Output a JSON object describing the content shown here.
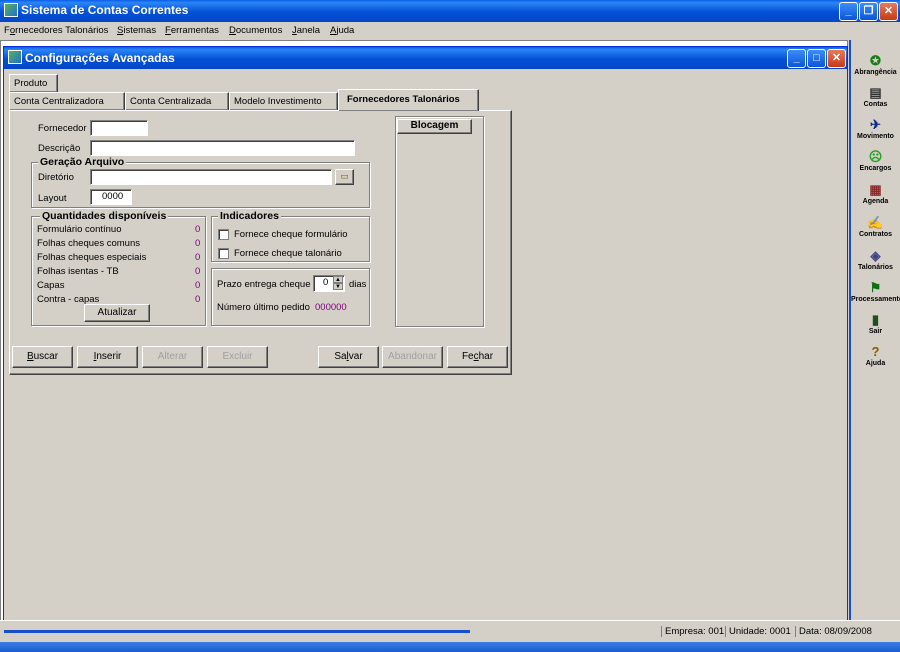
{
  "app": {
    "title": "Sistema de Contas Correntes",
    "menu": [
      {
        "pre": "F",
        "u": "o",
        "post": "rnecedores Talonários"
      },
      {
        "pre": "",
        "u": "S",
        "post": "istemas"
      },
      {
        "pre": "",
        "u": "F",
        "post": "erramentas"
      },
      {
        "pre": "",
        "u": "D",
        "post": "ocumentos"
      },
      {
        "pre": "",
        "u": "J",
        "post": "anela"
      },
      {
        "pre": "",
        "u": "A",
        "post": "juda"
      }
    ]
  },
  "window": {
    "title": "Configurações Avançadas",
    "tabs_row1": [
      "Produto"
    ],
    "tabs_row2": [
      "Conta Centralizadora",
      "Conta Centralizada",
      "Modelo Investimento",
      "Fornecedores Talonários"
    ],
    "form": {
      "fornecedor_label": "Fornecedor",
      "fornecedor_value": "",
      "descricao_label": "Descrição",
      "descricao_value": "",
      "geracao_title": "Geração Arquivo",
      "diretorio_label": "Diretório",
      "diretorio_value": "",
      "layout_label": "Layout",
      "layout_value": "0000",
      "quantidades_title": "Quantidades disponíveis",
      "quantidades": [
        {
          "label": "Formulário contínuo",
          "value": "0"
        },
        {
          "label": "Folhas cheques comuns",
          "value": "0"
        },
        {
          "label": "Folhas cheques especiais",
          "value": "0"
        },
        {
          "label": "Folhas isentas - TB",
          "value": "0"
        },
        {
          "label": "Capas",
          "value": "0"
        },
        {
          "label": "Contra - capas",
          "value": "0"
        }
      ],
      "atualizar": "Atualizar",
      "indicadores_title": "Indicadores",
      "chk_formulario": "Fornece cheque formulário",
      "chk_talonario": "Fornece cheque talonário",
      "prazo_label": "Prazo entrega cheque",
      "prazo_value": "0",
      "prazo_unit": "dias",
      "numero_label": "Número último pedido",
      "numero_value": "000000",
      "blocagem_header": "Blocagem"
    },
    "buttons": {
      "buscar": "Buscar",
      "inserir": "Inserir",
      "alterar": "Alterar",
      "excluir": "Excluir",
      "salvar": "Salvar",
      "abandonar": "Abandonar",
      "fechar": "Fechar"
    }
  },
  "sidebar": [
    {
      "label": "Abrangência",
      "icon": "globe-icon",
      "glyph": "✪",
      "color": "#1a7a1a"
    },
    {
      "label": "Contas",
      "icon": "document-icon",
      "glyph": "▤",
      "color": "#303030"
    },
    {
      "label": "Movimento",
      "icon": "runner-icon",
      "glyph": "✈",
      "color": "#102a8a"
    },
    {
      "label": "Encargos",
      "icon": "sad-face-icon",
      "glyph": "☹",
      "color": "#2aa02a"
    },
    {
      "label": "Agenda",
      "icon": "calendar-icon",
      "glyph": "▦",
      "color": "#8a2a2a"
    },
    {
      "label": "Contratos",
      "icon": "handshake-icon",
      "glyph": "✍",
      "color": "#806020"
    },
    {
      "label": "Talonários",
      "icon": "checkbook-icon",
      "glyph": "◈",
      "color": "#404080"
    },
    {
      "label": "Processamento",
      "icon": "flag-icon",
      "glyph": "⚑",
      "color": "#107010"
    },
    {
      "label": "Sair",
      "icon": "exit-door-icon",
      "glyph": "▮",
      "color": "#205020"
    },
    {
      "label": "Ajuda",
      "icon": "help-icon",
      "glyph": "?",
      "color": "#806000"
    }
  ],
  "status": {
    "empresa": "Empresa: 001",
    "unidade": "Unidade: 0001",
    "data": "Data:  08/09/2008"
  }
}
